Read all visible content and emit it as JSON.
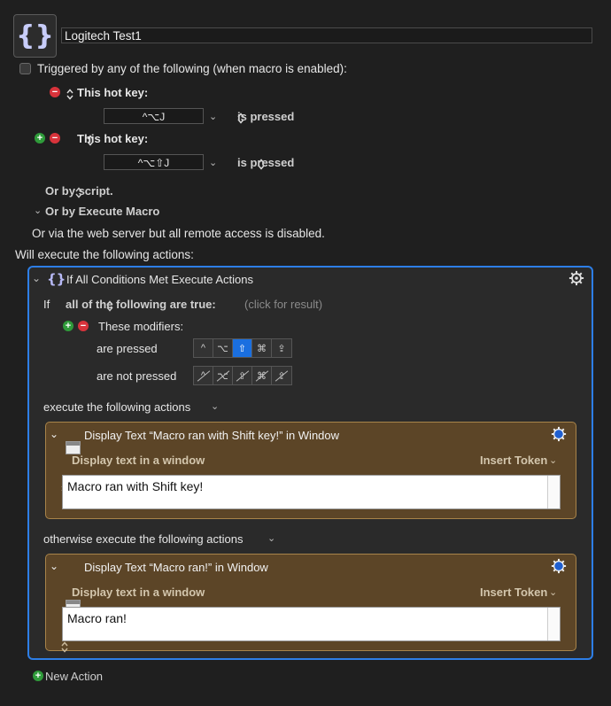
{
  "macro": {
    "icon_glyph": "{}",
    "name": "Logitech Test1"
  },
  "trigger": {
    "triggered_label": "Triggered by any of the following (when macro is enabled):",
    "hotkeys": [
      {
        "label": "This hot key:",
        "keys": "^⌥J",
        "state": "is pressed"
      },
      {
        "label": "This hot key:",
        "keys": "^⌥⇧J",
        "state": "is pressed"
      }
    ],
    "or_script": "Or by script.",
    "or_execute_macro": "Or by Execute Macro",
    "web_server_note": "Or via the web server but all remote access is disabled."
  },
  "actions_label": "Will execute the following actions:",
  "if_action": {
    "title": "If All Conditions Met Execute Actions",
    "if_word": "If",
    "condition_mode": "all of the following are true:",
    "click_result": "(click for result)",
    "condition": {
      "title": "These modifiers:",
      "pressed_label": "are pressed",
      "not_pressed_label": "are not pressed",
      "modifier_glyphs": [
        "^",
        "⌥",
        "⇧",
        "⌘",
        "⇪"
      ],
      "pressed_state": [
        "off",
        "off",
        "on",
        "off",
        "off"
      ]
    },
    "then_label": "execute the following actions",
    "else_label": "otherwise execute the following actions",
    "then_action": {
      "title": "Display Text “Macro ran with Shift key!” in Window",
      "mode": "Display text in a window",
      "insert_token": "Insert Token",
      "text": "Macro ran with Shift key!"
    },
    "else_action": {
      "title": "Display Text “Macro ran!” in Window",
      "mode": "Display text in a window",
      "insert_token": "Insert Token",
      "text": "Macro ran!"
    }
  },
  "new_action_label": "New Action",
  "colors": {
    "background": "#1f1f1f",
    "accent_blue": "#2d7ee6",
    "action_brown": "#5c4527",
    "minus_red": "#d8333b",
    "plus_green": "#2f9b3a"
  }
}
